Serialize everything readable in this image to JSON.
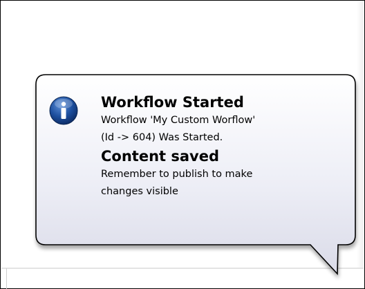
{
  "notification": {
    "icon": "info-icon",
    "accent_color": "#1a4f9c",
    "messages": [
      {
        "title": "Workflow Started",
        "lines": [
          "Workflow 'My Custom Worflow'",
          "(Id -> 604) Was Started."
        ]
      },
      {
        "title": "Content saved",
        "lines": [
          "Remember to publish to make",
          "changes visible"
        ]
      }
    ]
  }
}
